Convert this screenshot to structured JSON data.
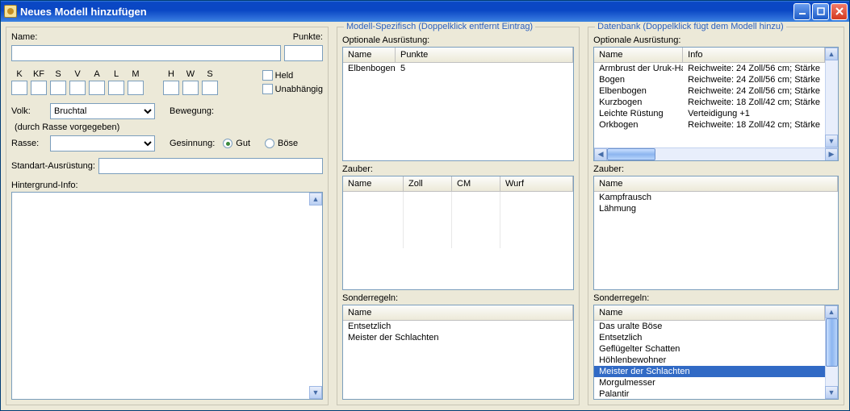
{
  "window": {
    "title": "Neues Modell hinzufügen"
  },
  "left": {
    "name_label": "Name:",
    "name_value": "",
    "points_label": "Punkte:",
    "points_value": "",
    "stats": [
      "K",
      "KF",
      "S",
      "V",
      "A",
      "L",
      "M",
      "H",
      "W",
      "S"
    ],
    "held_label": "Held",
    "unabh_label": "Unabhängig",
    "volk_label": "Volk:",
    "volk_value": "Bruchtal",
    "bewegung_label": "Bewegung:",
    "bewegung_note": "(durch Rasse vorgegeben)",
    "rasse_label": "Rasse:",
    "gesinnung_label": "Gesinnung:",
    "gut_label": "Gut",
    "boese_label": "Böse",
    "std_label": "Standart-Ausrüstung:",
    "hint_label": "Hintergrund-Info:"
  },
  "mid": {
    "legend": "Modell-Spezifisch (Doppelklick entfernt Eintrag)",
    "opt_label": "Optionale Ausrüstung:",
    "opt_headers": [
      "Name",
      "Punkte"
    ],
    "opt_rows": [
      [
        "Elbenbogen",
        "5"
      ]
    ],
    "zauber_label": "Zauber:",
    "zauber_headers": [
      "Name",
      "Zoll",
      "CM",
      "Wurf"
    ],
    "sonder_label": "Sonderregeln:",
    "sonder_headers": [
      "Name"
    ],
    "sonder_rows": [
      "Entsetzlich",
      "Meister der Schlachten"
    ]
  },
  "db": {
    "legend": "Datenbank (Doppelklick fügt dem Modell hinzu)",
    "opt_label": "Optionale Ausrüstung:",
    "opt_headers": [
      "Name",
      "Info"
    ],
    "opt_rows": [
      [
        "Armbrust der Uruk-Hai",
        "Reichweite: 24 Zoll/56 cm; Stärke"
      ],
      [
        "Bogen",
        "Reichweite: 24 Zoll/56 cm; Stärke"
      ],
      [
        "Elbenbogen",
        "Reichweite: 24 Zoll/56 cm; Stärke"
      ],
      [
        "Kurzbogen",
        "Reichweite: 18 Zoll/42 cm; Stärke"
      ],
      [
        "Leichte Rüstung",
        "Verteidigung +1"
      ],
      [
        "Orkbogen",
        "Reichweite: 18 Zoll/42 cm; Stärke"
      ]
    ],
    "zauber_label": "Zauber:",
    "zauber_headers": [
      "Name"
    ],
    "zauber_rows": [
      "Kampfrausch",
      "Lähmung"
    ],
    "sonder_label": "Sonderregeln:",
    "sonder_headers": [
      "Name"
    ],
    "sonder_rows": [
      "Das uralte Böse",
      "Entsetzlich",
      "Geflügelter Schatten",
      "Höhlenbewohner",
      "Meister der Schlachten",
      "Morgulmesser",
      "Palantir"
    ],
    "sonder_selected": 4
  }
}
